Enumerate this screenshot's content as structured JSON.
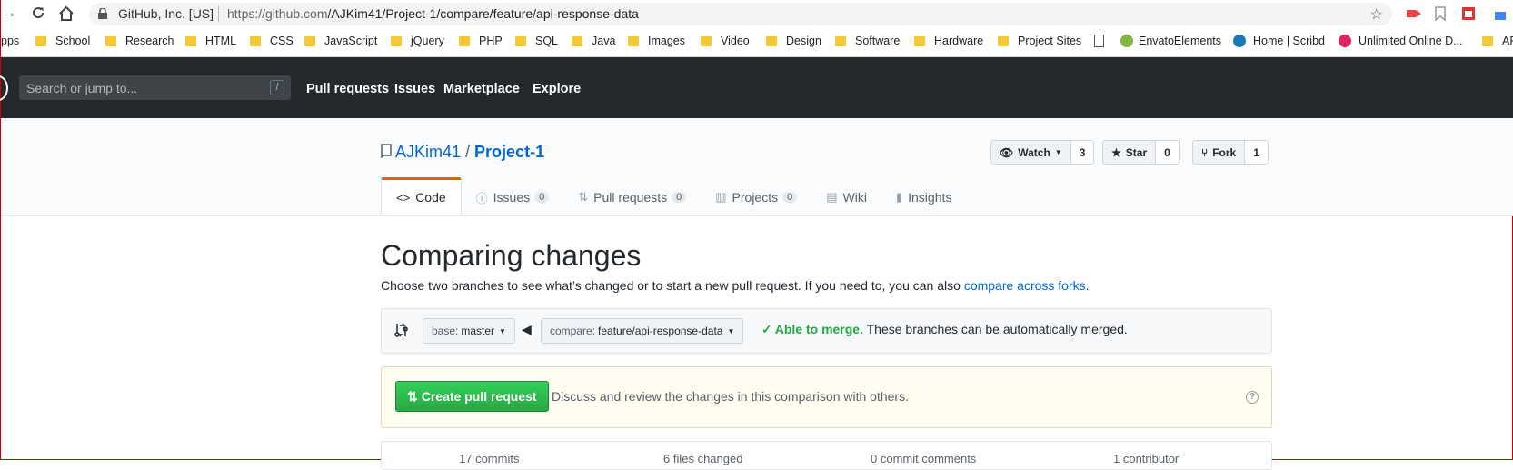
{
  "browser": {
    "site_identity": "GitHub, Inc. [US]",
    "url_prefix": "https://github.com",
    "url_path": "/AJKim41/Project-1/compare/feature/api-response-data"
  },
  "bookmarks": [
    {
      "label": "pps",
      "icon": "apps-icon"
    },
    {
      "label": "School",
      "icon": "folder-icon"
    },
    {
      "label": "Research",
      "icon": "folder-icon"
    },
    {
      "label": "HTML",
      "icon": "folder-icon"
    },
    {
      "label": "CSS",
      "icon": "folder-icon"
    },
    {
      "label": "JavaScript",
      "icon": "folder-icon"
    },
    {
      "label": "jQuery",
      "icon": "folder-icon"
    },
    {
      "label": "PHP",
      "icon": "folder-icon"
    },
    {
      "label": "SQL",
      "icon": "folder-icon"
    },
    {
      "label": "Java",
      "icon": "folder-icon"
    },
    {
      "label": "Images",
      "icon": "folder-icon"
    },
    {
      "label": "Video",
      "icon": "folder-icon"
    },
    {
      "label": "Design",
      "icon": "folder-icon"
    },
    {
      "label": "Software",
      "icon": "folder-icon"
    },
    {
      "label": "Hardware",
      "icon": "folder-icon"
    },
    {
      "label": "Project Sites",
      "icon": "folder-icon"
    },
    {
      "label": "EnvatoElements",
      "icon": "envato-icon"
    },
    {
      "label": "Home | Scribd",
      "icon": "scribd-icon"
    },
    {
      "label": "Unlimited Online D...",
      "icon": "circle-icon"
    },
    {
      "label": "AP",
      "icon": "folder-icon"
    }
  ],
  "header": {
    "search_placeholder": "Search or jump to...",
    "slash_key": "/",
    "nav": [
      "Pull requests",
      "Issues",
      "Marketplace",
      "Explore"
    ]
  },
  "repo": {
    "owner": "AJKim41",
    "separator": "/",
    "name": "Project-1",
    "watch_label": "Watch",
    "watch_count": "3",
    "star_label": "Star",
    "star_count": "0",
    "fork_label": "Fork",
    "fork_count": "1"
  },
  "tabs": [
    {
      "label": "Code",
      "count": ""
    },
    {
      "label": "Issues",
      "count": "0"
    },
    {
      "label": "Pull requests",
      "count": "0"
    },
    {
      "label": "Projects",
      "count": "0"
    },
    {
      "label": "Wiki",
      "count": ""
    },
    {
      "label": "Insights",
      "count": ""
    }
  ],
  "compare": {
    "title": "Comparing changes",
    "subtitle": "Choose two branches to see what’s changed or to start a new pull request. If you need to, you can also ",
    "subtitle_link": "compare across forks",
    "subtitle_end": ".",
    "base_label": "base:",
    "base_value": "master",
    "compare_label": "compare:",
    "compare_value": "feature/api-response-data",
    "merge_status": "Able to merge.",
    "merge_detail": " These branches can be automatically merged.",
    "create_button": "Create pull request",
    "create_desc": "Discuss and review the changes in this comparison with others.",
    "help": "?"
  },
  "stats_partial": [
    "17 commits",
    "6 files changed",
    "0 commit comments",
    "1 contributor"
  ],
  "colors": {
    "accent_orange": "#e36209",
    "link_blue": "#0366d6",
    "merge_green": "#28a745",
    "header_dark": "#24292e"
  }
}
